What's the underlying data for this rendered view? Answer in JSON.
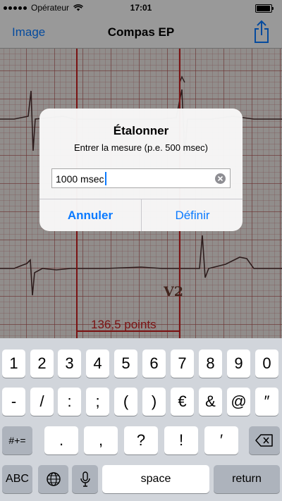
{
  "status_bar": {
    "carrier": "Opérateur",
    "time": "17:01"
  },
  "nav": {
    "left_button": "Image",
    "title": "Compas EP",
    "share_icon": "share-icon"
  },
  "ecg": {
    "caliper_label": "136,5 points",
    "lead_label": "V2"
  },
  "alert": {
    "title": "Étalonner",
    "message": "Entrer la mesure (p.e. 500 msec)",
    "field_value": "1000 msec",
    "cancel_label": "Annuler",
    "ok_label": "Définir"
  },
  "keyboard": {
    "row1": [
      "1",
      "2",
      "3",
      "4",
      "5",
      "6",
      "7",
      "8",
      "9",
      "0"
    ],
    "row2": [
      "-",
      "/",
      ":",
      ";",
      "(",
      ")",
      "€",
      "&",
      "@",
      "″"
    ],
    "row3_left": "#+=",
    "row3": [
      ".",
      ",",
      "?",
      "!",
      "′"
    ],
    "row4": {
      "abc": "ABC",
      "space": "space",
      "return": "return"
    }
  },
  "colors": {
    "accent": "#0a7aff",
    "caliper": "#c62020"
  }
}
